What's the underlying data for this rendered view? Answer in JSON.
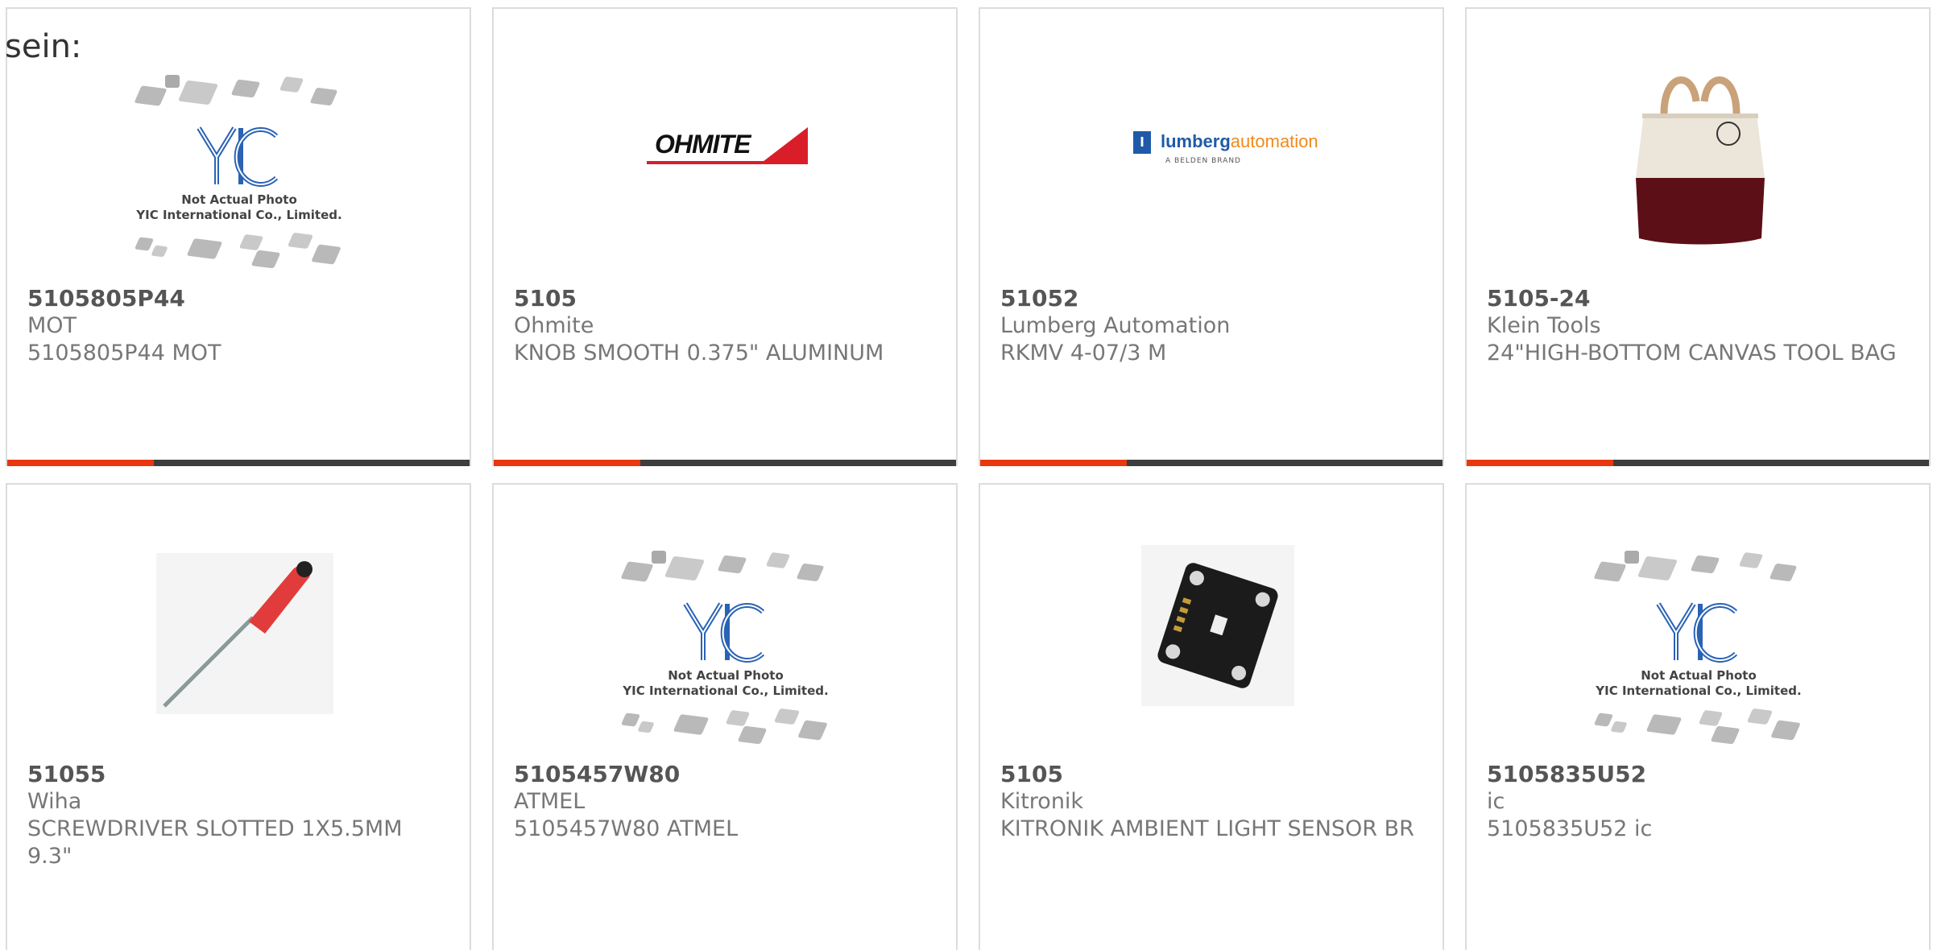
{
  "page": {
    "heading": "sein:"
  },
  "placeholder": {
    "logo_text": "YIC",
    "line1": "Not Actual Photo",
    "line2": "YIC International Co., Limited."
  },
  "brand_logos": {
    "ohmite": "OHMITE",
    "lumberg_main": "lumberg",
    "lumberg_accent": "automation",
    "lumberg_sub": "A BELDEN BRAND"
  },
  "products": [
    {
      "part": "5105805P44",
      "manufacturer": "MOT",
      "description": "5105805P44 MOT",
      "image": "placeholder-image"
    },
    {
      "part": "5105",
      "manufacturer": "Ohmite",
      "description": "KNOB SMOOTH 0.375\" ALUMINUM",
      "image": "ohmite-logo"
    },
    {
      "part": "51052",
      "manufacturer": "Lumberg Automation",
      "description": "RKMV 4-07/3 M",
      "image": "lumberg-logo"
    },
    {
      "part": "5105-24",
      "manufacturer": "Klein Tools",
      "description": "24\"HIGH-BOTTOM CANVAS TOOL BAG",
      "image": "tool-bag-photo"
    },
    {
      "part": "51055",
      "manufacturer": "Wiha",
      "description": "SCREWDRIVER SLOTTED 1X5.5MM 9.3\"",
      "image": "screwdriver-photo"
    },
    {
      "part": "5105457W80",
      "manufacturer": "ATMEL",
      "description": "5105457W80 ATMEL",
      "image": "placeholder-image"
    },
    {
      "part": "5105",
      "manufacturer": "Kitronik",
      "description": "KITRONIK AMBIENT LIGHT SENSOR BR",
      "image": "sensor-board-photo"
    },
    {
      "part": "5105835U52",
      "manufacturer": "ic",
      "description": "5105835U52 ic",
      "image": "placeholder-image"
    }
  ],
  "colors": {
    "accent": "#e8380f",
    "bar": "#3d3d3d",
    "border": "#dcdcdc",
    "part_text": "#555555",
    "body_text": "#777777"
  }
}
